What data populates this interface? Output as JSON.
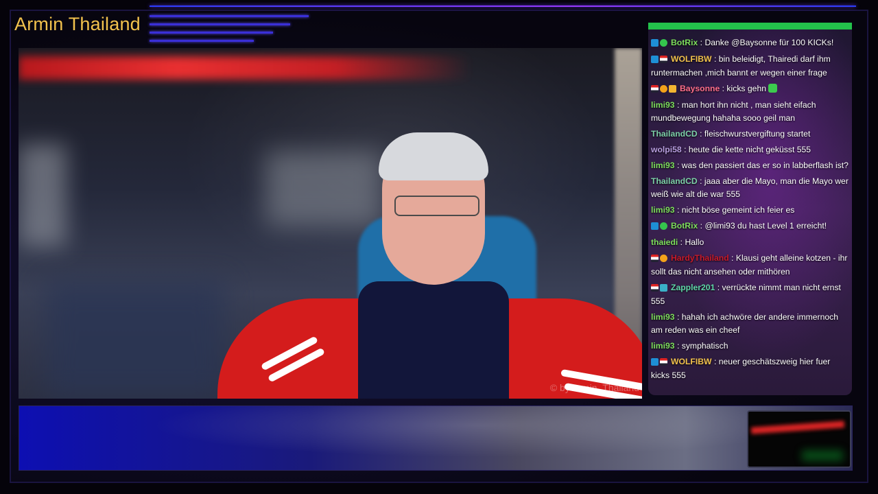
{
  "stream": {
    "title": "Armin Thailand",
    "watermark": "© by Armin_Thailand"
  },
  "colors": {
    "title": "#f2c24d",
    "accent_blue": "#2b3dff",
    "accent_purple": "#9b39ff",
    "chat_top_bar": "#23c24b"
  },
  "chat": {
    "messages": [
      {
        "user": "BotRix",
        "user_color": "#7dde5c",
        "badges": [
          "bot",
          "ok"
        ],
        "text": "Danke @Baysonne für 100 KICKs!"
      },
      {
        "user": "WOLFIBW",
        "user_color": "#f2c24d",
        "badges": [
          "bot",
          "flag"
        ],
        "text": "bin beleidigt, Thairedi darf ihm runtermachen ,mich bannt er wegen einer frage"
      },
      {
        "user": "Baysonne",
        "user_color": "#ff6e8a",
        "badges": [
          "flag",
          "one",
          "crown"
        ],
        "text": "kicks gehn",
        "emote": "green-emote"
      },
      {
        "user": "limi93",
        "user_color": "#7dde5c",
        "badges": [],
        "text": "man hort ihn nicht , man sieht eifach mundbewegung hahaha sooo geil man"
      },
      {
        "user": "ThailandCD",
        "user_color": "#7dd0a8",
        "badges": [],
        "text": "fleischwurstvergiftung startet"
      },
      {
        "user": "wolpi58",
        "user_color": "#b79ddf",
        "badges": [],
        "text": "heute die kette nicht geküsst 555"
      },
      {
        "user": "limi93",
        "user_color": "#7dde5c",
        "badges": [],
        "text": "was den passiert das er so in labberflash ist?"
      },
      {
        "user": "ThailandCD",
        "user_color": "#7dd0a8",
        "badges": [],
        "text": "jaaa aber die Mayo, man die Mayo wer weiß wie alt die war 555"
      },
      {
        "user": "limi93",
        "user_color": "#7dde5c",
        "badges": [],
        "text": "nicht böse gemeint ich feier es"
      },
      {
        "user": "BotRix",
        "user_color": "#7dde5c",
        "badges": [
          "bot",
          "ok"
        ],
        "text": "@limi93 du hast Level 1 erreicht!"
      },
      {
        "user": "thaiedi",
        "user_color": "#7dde5c",
        "badges": [],
        "text": "Hallo"
      },
      {
        "user": "HardyThailand",
        "user_color": "#c81a2a",
        "badges": [
          "flag",
          "one"
        ],
        "text": "Klausi geht alleine kotzen - ihr sollt das nicht ansehen oder mithören"
      },
      {
        "user": "Zappler201",
        "user_color": "#5fd6a8",
        "badges": [
          "flag",
          "gift"
        ],
        "text": "verrückte nimmt man nicht ernst 555"
      },
      {
        "user": "limi93",
        "user_color": "#7dde5c",
        "badges": [],
        "text": "hahah ich achwöre der andere immernoch am reden was ein cheef"
      },
      {
        "user": "limi93",
        "user_color": "#7dde5c",
        "badges": [],
        "text": "symphatisch"
      },
      {
        "user": "WOLFIBW",
        "user_color": "#f2c24d",
        "badges": [
          "bot",
          "flag"
        ],
        "text": "neuer geschätszweig hier fuer kicks 555"
      }
    ]
  }
}
